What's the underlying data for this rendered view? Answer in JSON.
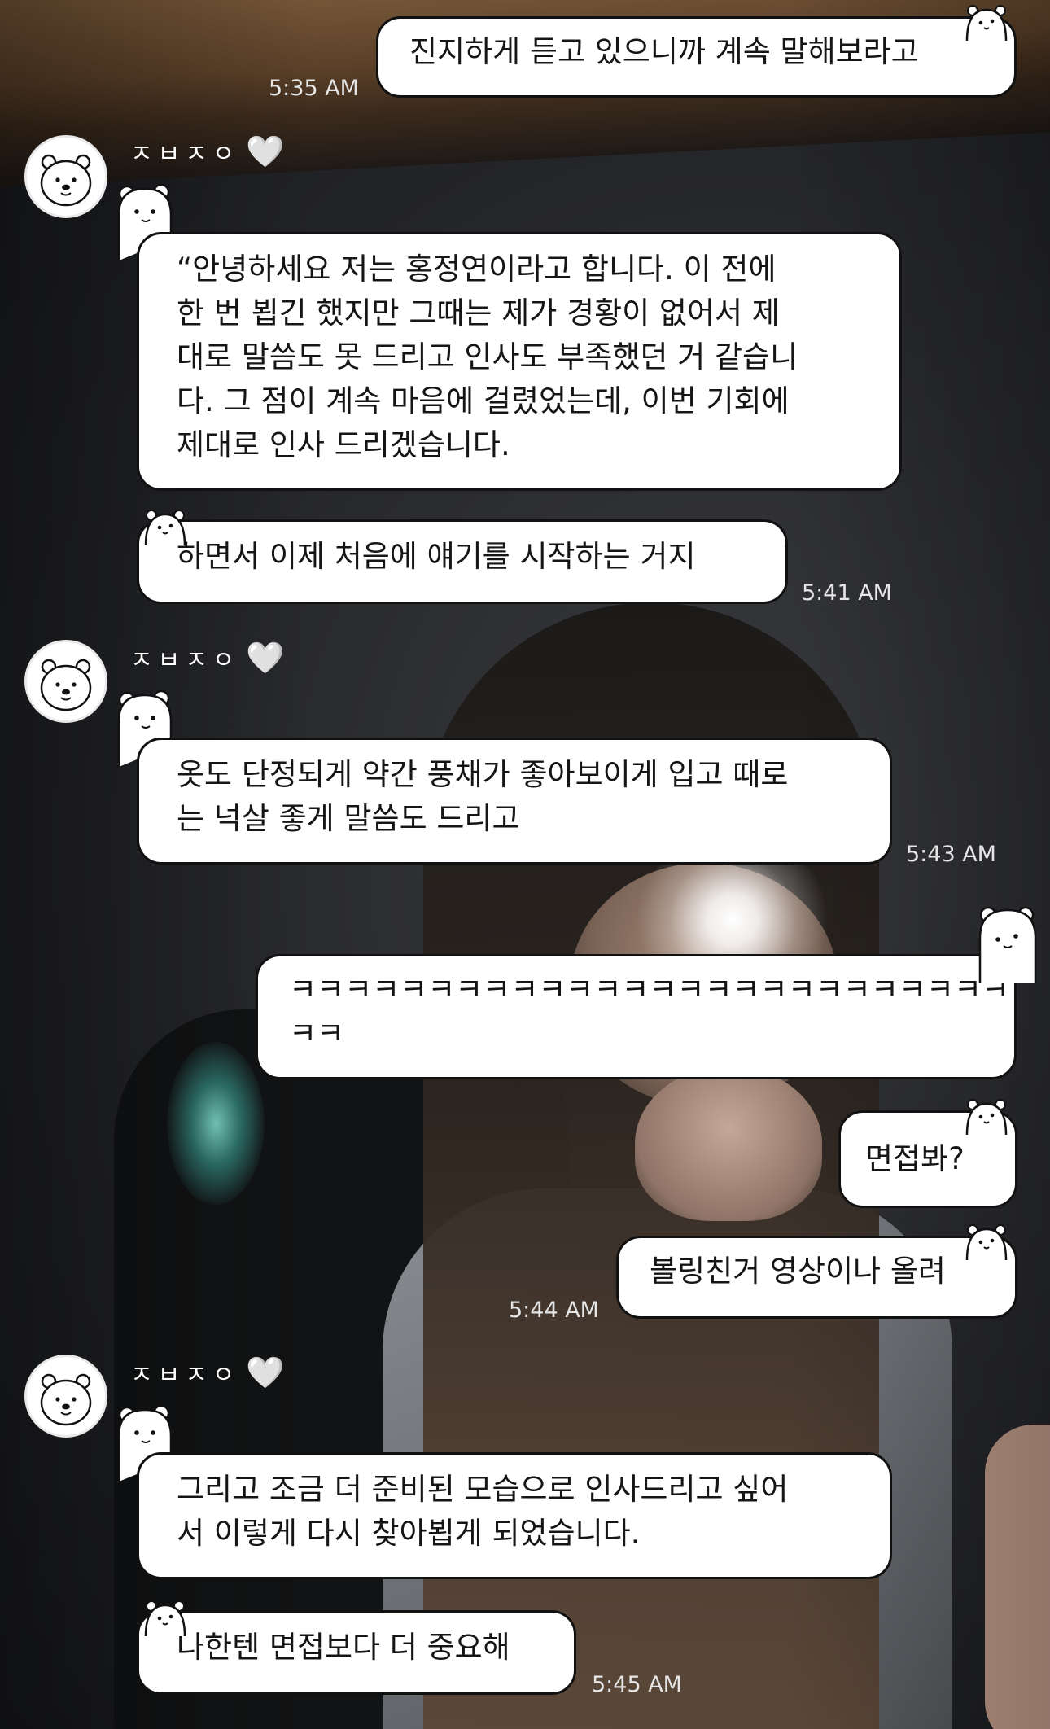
{
  "messages": [
    {
      "side": "right",
      "text": "진지하게 듣고 있으니까 계속 말해보라고",
      "time": "5:35 AM"
    },
    {
      "side": "left",
      "sender": "ㅈㅂㅈㅇ",
      "heart": "🤍",
      "text": "“안녕하세요 저는 홍정연이라고 합니다. 이 전에\n한 번 뵙긴 했지만 그때는 제가 경황이 없어서 제\n대로 말씀도 못 드리고 인사도 부족했던 거 같습니\n다. 그 점이 계속 마음에 걸렸었는데, 이번 기회에\n제대로 인사 드리겠습니다."
    },
    {
      "side": "left",
      "text": "하면서 이제 처음에 얘기를 시작하는 거지",
      "time": "5:41 AM"
    },
    {
      "side": "left",
      "sender": "ㅈㅂㅈㅇ",
      "heart": "🤍",
      "text": "옷도 단정되게 약간 풍채가 좋아보이게 입고 때로\n는 넉살 좋게 말씀도 드리고",
      "time": "5:43 AM"
    },
    {
      "side": "right",
      "text": "ㅋㅋㅋㅋㅋㅋㅋㅋㅋㅋㅋㅋㅋㅋㅋㅋㅋㅋㅋㅋㅋㅋㅋㅋㅋㅋ\nㅋㅋ"
    },
    {
      "side": "right",
      "text": "면접봐?"
    },
    {
      "side": "right",
      "text": "볼링친거 영상이나 올려",
      "time": "5:44 AM"
    },
    {
      "side": "left",
      "sender": "ㅈㅂㅈㅇ",
      "heart": "🤍",
      "text": "그리고 조금 더 준비된 모습으로 인사드리고 싶어\n서 이렇게 다시 찾아뵙게 되었습니다."
    },
    {
      "side": "left",
      "text": "나한텐 면접보다 더 중요해",
      "time": "5:45 AM"
    }
  ],
  "icons": {
    "avatar": "polar-bear-icon",
    "peek": "bear-peek-icon",
    "heart": "white-heart-icon"
  }
}
